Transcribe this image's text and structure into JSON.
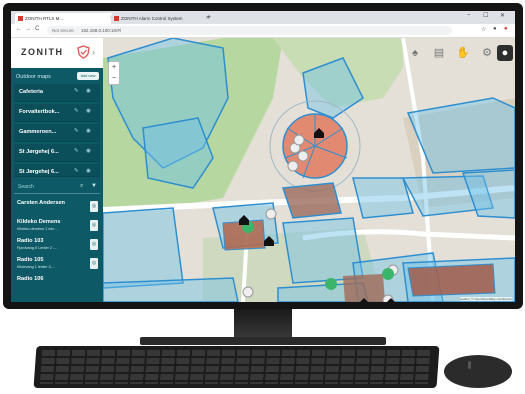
{
  "browser": {
    "tabs": [
      {
        "title": "ZONITH RTLS M..."
      },
      {
        "title": "ZONITH Alarm Control System"
      }
    ],
    "new_tab": "+",
    "window_controls": [
      "–",
      "☐",
      "✕"
    ],
    "nav": {
      "back": "←",
      "forward": "→",
      "reload": "C"
    },
    "url_security": "Not secure",
    "url": "192.168.0.100:10/#/"
  },
  "app": {
    "logo": "ZONITH",
    "collapse": "›",
    "sidebar": {
      "heading": "Outdoor maps",
      "add_new": "Add new",
      "maps": [
        {
          "label": "Cafeteria"
        },
        {
          "label": "Forvaltertbok..."
        },
        {
          "label": "Gammeroen..."
        },
        {
          "label": "St Jørgehej 6..."
        },
        {
          "label": "St Jørgehej 6..."
        }
      ],
      "search_placeholder": "Search",
      "units": [
        {
          "name": "Carsten Andersen",
          "status": ""
        },
        {
          "name": "Kildeko Demens",
          "status": "Kildeko demens 1 min ..."
        },
        {
          "name": "Radio 103",
          "status": "Fjordvang 6 Lenter 2 -..."
        },
        {
          "name": "Radio 105",
          "status": "Kildevang 1 lenter 3-..."
        },
        {
          "name": "Radio 106",
          "status": ""
        }
      ]
    },
    "top_icons": [
      "bell-icon",
      "building-icon",
      "hand-icon",
      "gear-icon",
      "user-icon"
    ],
    "map": {
      "zoom_in": "+",
      "zoom_out": "−",
      "attribution": "Leaflet | © OpenStreetMap contributors"
    }
  },
  "colors": {
    "sidebar": "#0d5a66",
    "zone_blue": "#3ea3dc",
    "zone_orange": "#e07a5f",
    "marker_green": "#3bb56a",
    "accent_red": "#e05a5a"
  }
}
